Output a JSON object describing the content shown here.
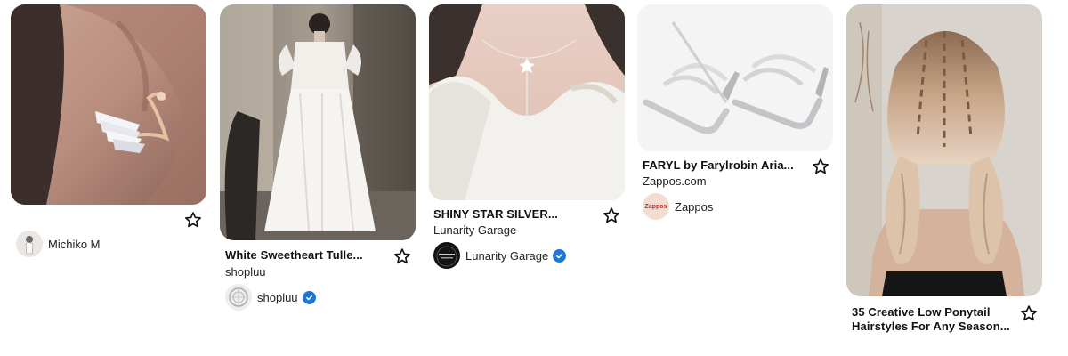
{
  "pins": [
    {
      "image_description": "swan-earring-photo",
      "title": "",
      "source": "",
      "creator": {
        "name": "Michiko M",
        "avatar_icon": "avatar-figure-icon",
        "verified": false
      }
    },
    {
      "image_description": "white-tulle-dress-photo",
      "title": "White Sweetheart Tulle...",
      "source": "shopluu",
      "creator": {
        "name": "shopluu",
        "avatar_icon": "avatar-lace-icon",
        "verified": true
      }
    },
    {
      "image_description": "star-necklace-photo",
      "title": "SHINY STAR SILVER...",
      "source": "Lunarity Garage",
      "creator": {
        "name": "Lunarity Garage",
        "avatar_text": "LUNARITY\nGARAGE",
        "verified": true
      }
    },
    {
      "image_description": "silver-sandals-photo",
      "title": "FARYL by Farylrobin Aria...",
      "source": "Zappos.com",
      "creator": {
        "name": "Zappos",
        "avatar_text": "Zappos",
        "verified": false
      }
    },
    {
      "image_description": "braided-ponytail-photo",
      "title": "35 Creative Low Ponytail Hairstyles For Any Season...",
      "source": "",
      "creator": null
    }
  ],
  "colors": {
    "verified_badge": "#1d76db",
    "text_primary": "#111111",
    "zappos_avatar_bg": "#f3ddd3",
    "zappos_avatar_text": "#b23a3a"
  }
}
